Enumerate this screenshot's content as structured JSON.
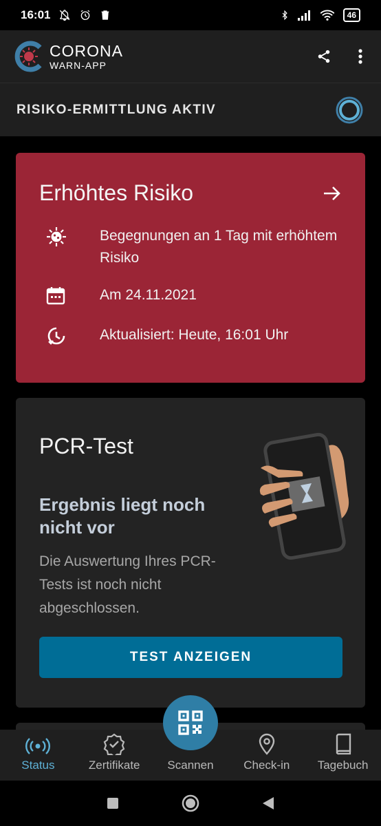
{
  "statusbar": {
    "time": "16:01",
    "battery": "46"
  },
  "appbar": {
    "title": "CORONA",
    "subtitle": "WARN-APP",
    "icons": [
      "share-icon",
      "more-vert-icon"
    ]
  },
  "risk_status": {
    "label": "RISIKO-ERMITTLUNG AKTIV",
    "icon": "risk-scanning-ring-icon"
  },
  "risk_card": {
    "title": "Erhöhtes Risiko",
    "color": "#9b2536",
    "items": [
      {
        "icon": "virus-icon",
        "text": "Begegnungen an 1 Tag mit erhöhtem Risiko"
      },
      {
        "icon": "calendar-icon",
        "text": "Am 24.11.2021"
      },
      {
        "icon": "history-clock-icon",
        "text": "Aktualisiert: Heute, 16:01 Uhr"
      }
    ]
  },
  "pcr_card": {
    "title": "PCR-Test",
    "subtitle": "Ergebnis liegt noch nicht vor",
    "body": "Die Auswertung Ihres PCR-Tests ist noch nicht abgeschlossen.",
    "button": "TEST ANZEIGEN"
  },
  "bottom_nav": {
    "items": [
      {
        "label": "Status",
        "icon": "broadcast-icon",
        "active": true
      },
      {
        "label": "Zertifikate",
        "icon": "certificate-badge-icon",
        "active": false
      },
      {
        "label": "Scannen",
        "icon": "qr-code-icon",
        "active": false
      },
      {
        "label": "Check-in",
        "icon": "location-pin-icon",
        "active": false
      },
      {
        "label": "Tagebuch",
        "icon": "book-icon",
        "active": false
      }
    ]
  },
  "colors": {
    "accent": "#5eb1d6",
    "button": "#006d96",
    "fab": "#2f7ea6"
  }
}
